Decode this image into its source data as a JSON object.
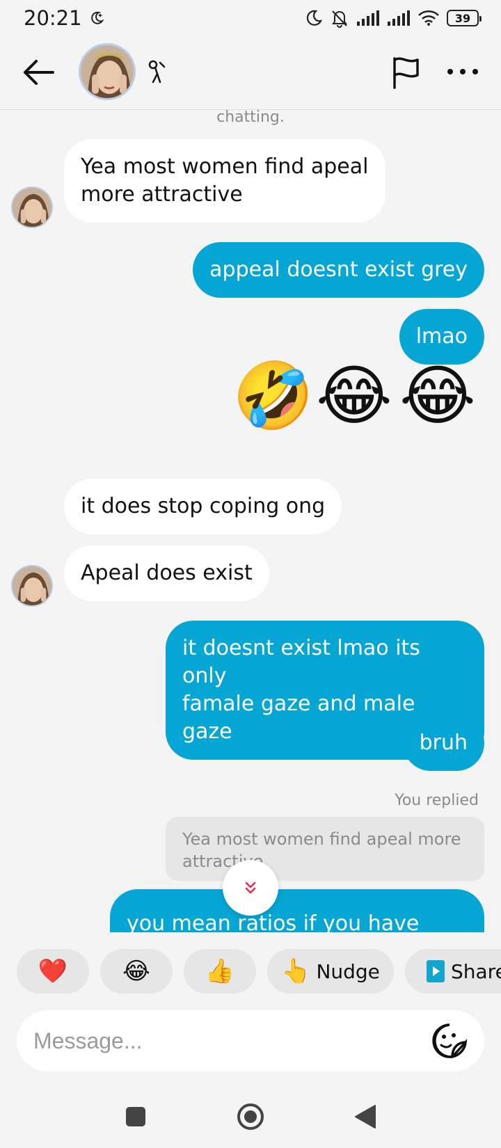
{
  "status_bar": {
    "time": "20:21",
    "battery": "39",
    "icons": [
      "moon-icon",
      "bell-muted-icon",
      "signal-icon",
      "signal-icon",
      "wifi-icon",
      "battery-icon"
    ]
  },
  "header": {
    "icons": [
      "back-arrow-icon",
      "avatar",
      "zodiac-icon",
      "flag-icon",
      "more-icon"
    ]
  },
  "chat": {
    "system_note": "chatting.",
    "messages": [
      {
        "dir": "in",
        "text": "Yea most women find apeal\nmore attractive"
      },
      {
        "dir": "out",
        "text": "appeal doesnt exist grey"
      },
      {
        "dir": "out",
        "text": "lmao"
      },
      {
        "dir": "out",
        "type": "emoji",
        "text": "🤣😂😂"
      },
      {
        "dir": "in",
        "text": "it does stop coping ong"
      },
      {
        "dir": "in",
        "text": "Apeal does exist"
      },
      {
        "dir": "out",
        "text": "it doesnt exist lmao its only\nfamale gaze and male gaze"
      },
      {
        "dir": "out",
        "text": "bruh"
      },
      {
        "dir": "out",
        "reply": true,
        "text": "you mean ratios if you have good"
      }
    ],
    "you_replied": "You replied",
    "quoted_text": "Yea most women find apeal more attractive",
    "emojis": [
      "🤣",
      "😂",
      "😂"
    ]
  },
  "reactions": [
    {
      "emoji": "❤️",
      "label": ""
    },
    {
      "emoji": "😂",
      "label": ""
    },
    {
      "emoji": "👍",
      "label": ""
    },
    {
      "emoji": "👆",
      "label": "Nudge"
    },
    {
      "emoji": "",
      "label": "Share"
    }
  ],
  "composer": {
    "placeholder": "Message...",
    "value": ""
  },
  "colors": {
    "outgoing_bubble": "#05a6d3",
    "incoming_bubble": "#ffffff",
    "background": "#f4f4f4"
  }
}
